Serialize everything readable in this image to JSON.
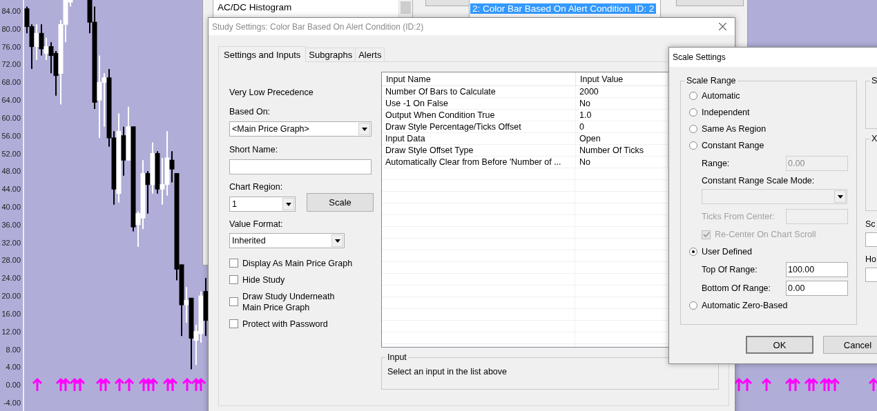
{
  "chart": {
    "chart_data": {
      "type": "candlestick",
      "ylim": [
        -5.86,
        86.48
      ],
      "yticks": [
        {
          "value": 84,
          "label": "84.00"
        },
        {
          "value": 80,
          "label": "80.00"
        },
        {
          "value": 76,
          "label": "76.00"
        },
        {
          "value": 72,
          "label": "72.00"
        },
        {
          "value": 68,
          "label": "68.00"
        },
        {
          "value": 64,
          "label": "64.00"
        },
        {
          "value": 60,
          "label": "60.00"
        },
        {
          "value": 56,
          "label": "56.00"
        },
        {
          "value": 52,
          "label": "52.00"
        },
        {
          "value": 48,
          "label": "48.00"
        },
        {
          "value": 44,
          "label": "44.00"
        },
        {
          "value": 40,
          "label": "40.00"
        },
        {
          "value": 36,
          "label": "36.00"
        },
        {
          "value": 32,
          "label": "32.00"
        },
        {
          "value": 28,
          "label": "28.00"
        },
        {
          "value": 24,
          "label": "24.00"
        },
        {
          "value": 20,
          "label": "20.00"
        },
        {
          "value": 16,
          "label": "16.00"
        },
        {
          "value": 12,
          "label": "12.00"
        },
        {
          "value": 8,
          "label": "8.00"
        },
        {
          "value": 4,
          "label": "4.00"
        },
        {
          "value": 0,
          "label": "0.00"
        },
        {
          "value": -4,
          "label": "-4.00"
        }
      ],
      "categories": [
        null,
        null,
        null,
        null,
        null,
        null,
        null,
        null,
        null,
        null,
        null,
        null,
        null,
        null,
        null,
        null,
        null,
        null,
        null,
        null,
        null,
        null,
        null,
        null,
        null,
        null,
        null,
        null,
        null,
        null,
        null,
        null,
        null,
        null,
        null,
        null,
        null,
        null
      ],
      "ohlc": [
        [
          84.5,
          85,
          79,
          80.5
        ],
        [
          80.5,
          81,
          71,
          76
        ],
        [
          76,
          81,
          73,
          79
        ],
        [
          79,
          81,
          74,
          75.5
        ],
        [
          74.5,
          78,
          73,
          76
        ],
        [
          76,
          77,
          70,
          74
        ],
        [
          74.5,
          75,
          65,
          69.5
        ],
        [
          70,
          82,
          63,
          81
        ],
        [
          81,
          90,
          77,
          88
        ],
        [
          86,
          92,
          85,
          90
        ],
        null,
        null,
        null,
        [
          90,
          92,
          79,
          81.5
        ],
        [
          81.5,
          85,
          62,
          63.5
        ],
        [
          64,
          74,
          55.5,
          68
        ],
        [
          68,
          70,
          58,
          69
        ],
        [
          69,
          71,
          53.5,
          55.5
        ],
        [
          55.5,
          57,
          40.5,
          44
        ],
        [
          43,
          61,
          41,
          57
        ],
        [
          56,
          58,
          47,
          50.5
        ],
        [
          50.5,
          62.5,
          50.5,
          58
        ],
        [
          58,
          58,
          34.5,
          35.5
        ],
        [
          36,
          39,
          31,
          38.5
        ],
        [
          37.5,
          50.5,
          35,
          47.5
        ],
        [
          47.5,
          48,
          38.5,
          45
        ],
        [
          45,
          54.5,
          43,
          52
        ],
        [
          52,
          52.5,
          43,
          44
        ],
        [
          44,
          51,
          40.5,
          45
        ],
        [
          45,
          57,
          42.5,
          51
        ],
        [
          50.5,
          52.5,
          45.5,
          48.5
        ],
        [
          47.5,
          47.5,
          23.5,
          26
        ],
        [
          27,
          27,
          11,
          18
        ],
        [
          18,
          22,
          14,
          19
        ],
        [
          19.5,
          19.5,
          3.5,
          10.5
        ],
        [
          10,
          13.5,
          4.5,
          12
        ],
        [
          11.5,
          21,
          9.5,
          20
        ],
        [
          21,
          24,
          11,
          14.5
        ]
      ]
    }
  },
  "back_window": {
    "study_list": [
      "AC/DC Histogram"
    ],
    "chart_studies": [
      {
        "label": "2: Color Bar Based On Alert Condition. ID: 2",
        "selected": true
      }
    ]
  },
  "study_settings": {
    "title": "Study Settings: Color Bar Based On Alert Condition (ID:2)",
    "active": false,
    "tabs": [
      {
        "label": "Settings and Inputs",
        "selected": true
      },
      {
        "label": "Subgraphs",
        "selected": false
      },
      {
        "label": "Alerts",
        "selected": false
      }
    ],
    "precedence": "Very Low Precedence",
    "based_on": {
      "label": "Based On:",
      "value": "<Main Price Graph>"
    },
    "short_name": {
      "label": "Short Name:"
    },
    "chart_region": {
      "label": "Chart Region:",
      "value": "1"
    },
    "scale_button": "Scale",
    "value_format": {
      "label": "Value Format:",
      "value": "Inherited"
    },
    "checkboxes": [
      {
        "label": "Display As Main Price Graph",
        "checked": false
      },
      {
        "label": "Hide Study",
        "checked": false
      },
      {
        "label": "Draw Study Underneath Main Price Graph",
        "checked": false
      },
      {
        "label": "Protect with Password",
        "checked": false
      }
    ],
    "inputs_table": {
      "columns": [
        "Input Name",
        "Input Value"
      ],
      "rows": [
        {
          "name": "Number Of Bars to Calculate",
          "value": "2000"
        },
        {
          "name": "Use -1 On False",
          "value": "No"
        },
        {
          "name": "Output When Condition True",
          "value": "1.0"
        },
        {
          "name": "Draw Style Percentage/Ticks Offset",
          "value": "0"
        },
        {
          "name": "Input Data",
          "value": "Open"
        },
        {
          "name": "Draw Style Offset Type",
          "value": "Number Of Ticks"
        },
        {
          "name": "Automatically Clear from Before 'Number of ...",
          "value": "No"
        }
      ]
    },
    "input_box": {
      "title": "Input",
      "text": "Select an input in the list above"
    }
  },
  "scale_settings": {
    "title": "Scale Settings",
    "active": true,
    "scale_range": {
      "title": "Scale Range",
      "options": [
        {
          "label": "Automatic",
          "selected": false
        },
        {
          "label": "Independent",
          "selected": false
        },
        {
          "label": "Same As Region",
          "selected": false
        },
        {
          "label": "Constant Range",
          "selected": false,
          "children": [
            {
              "kind": "field",
              "label": "Range:",
              "value": "0.00",
              "disabled": true
            },
            {
              "kind": "select",
              "label": "Constant Range Scale Mode:",
              "disabled": true
            },
            {
              "kind": "field",
              "label": "Ticks From Center:",
              "disabled": true,
              "label_disabled": true
            },
            {
              "kind": "checkbox",
              "label": "Re-Center On Chart Scroll",
              "checked": true,
              "disabled": true
            }
          ]
        },
        {
          "label": "User Defined",
          "selected": true,
          "children": [
            {
              "kind": "field",
              "label": "Top Of Range:",
              "value": "100.00",
              "disabled": false
            },
            {
              "kind": "field",
              "label": "Bottom Of Range:",
              "value": "0.00",
              "disabled": false
            }
          ]
        },
        {
          "label": "Automatic Zero-Based",
          "selected": false
        }
      ]
    },
    "side_groups": [
      "S",
      "X"
    ],
    "side_labels": [
      "Sc",
      "Ho"
    ],
    "buttons": [
      "OK",
      "Cancel"
    ]
  }
}
